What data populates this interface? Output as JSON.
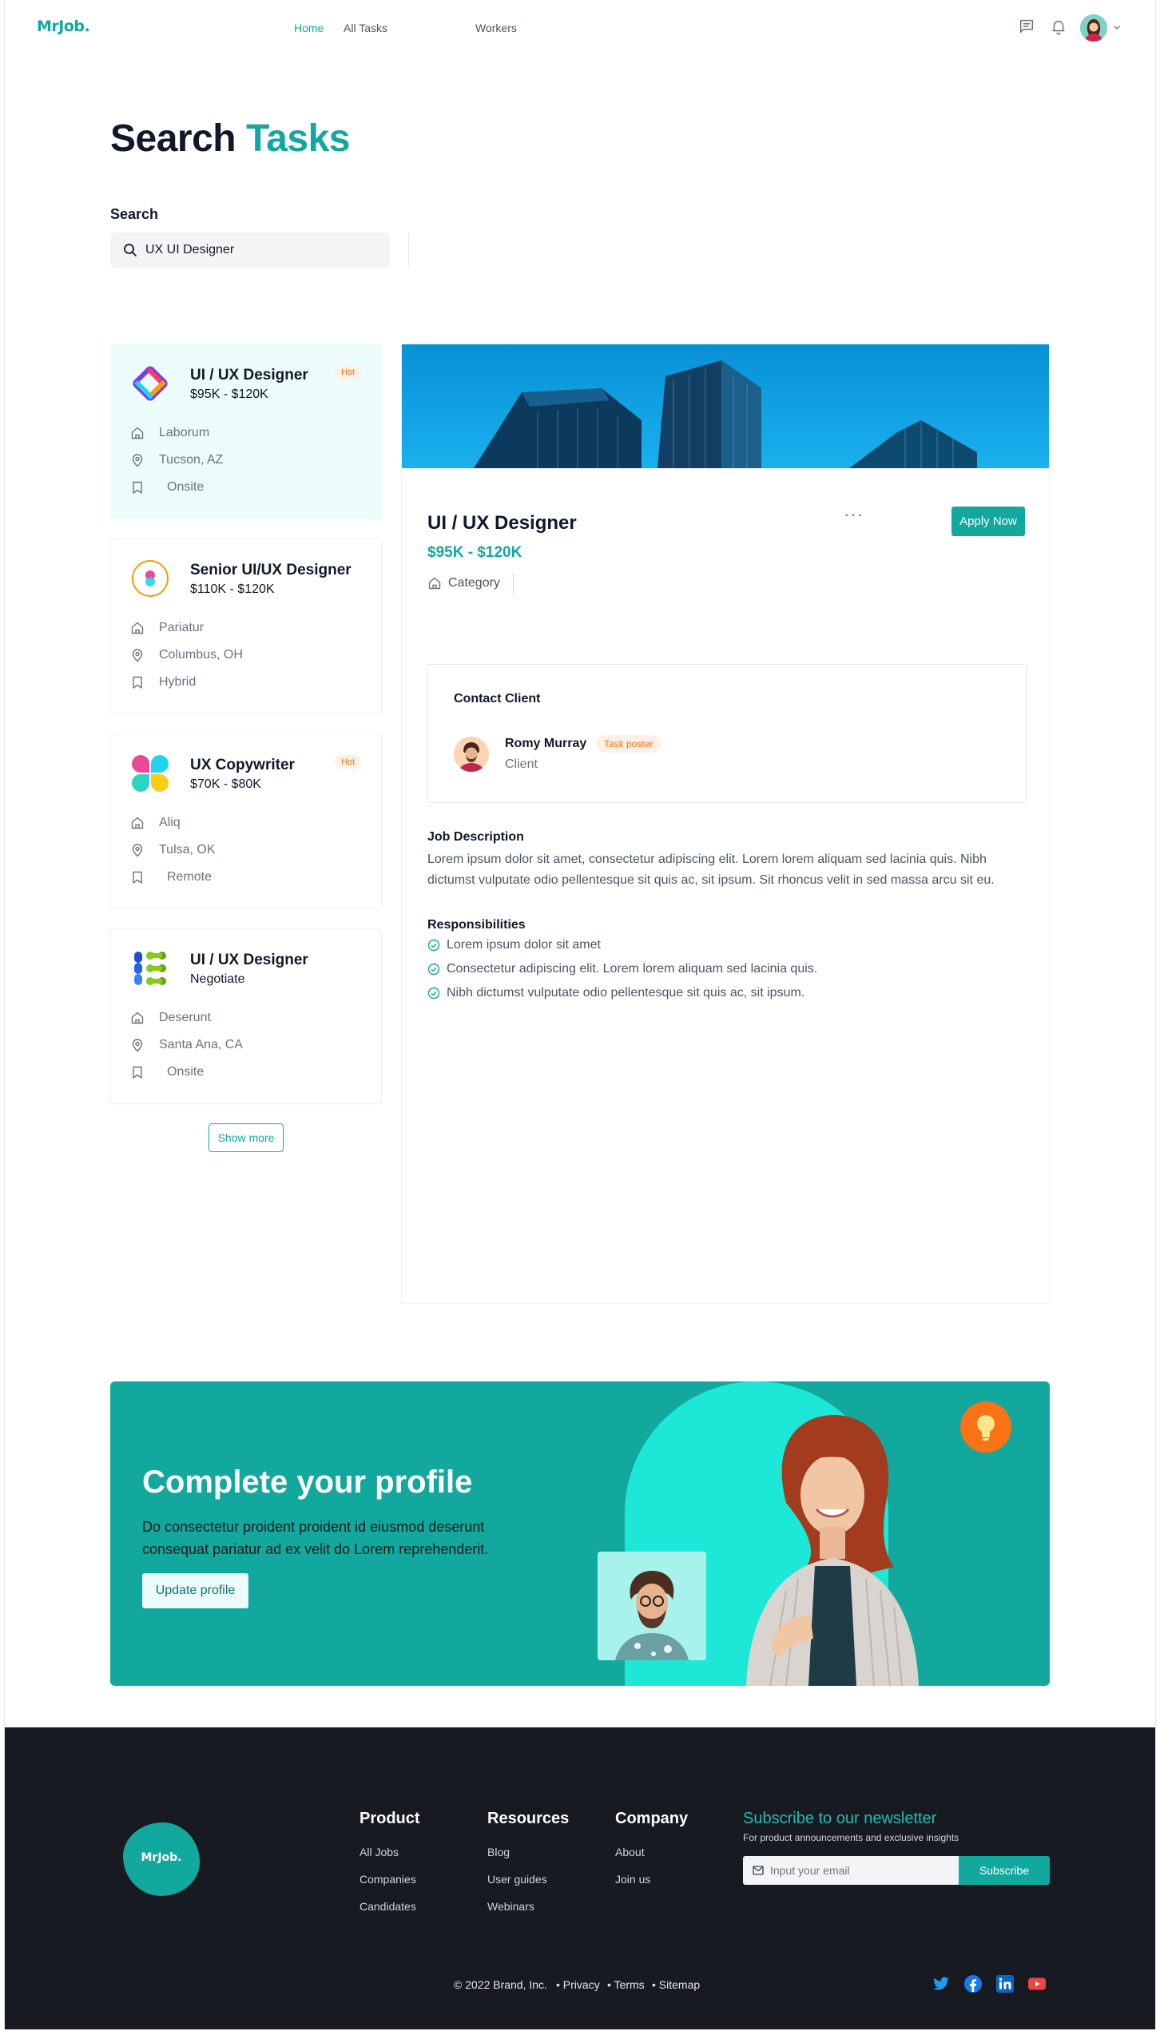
{
  "header": {
    "logo": "MrJob.",
    "nav": [
      {
        "label": "Home",
        "active": true
      },
      {
        "label": "All Tasks",
        "active": false
      },
      {
        "label": "Workers",
        "active": false
      }
    ],
    "icons": [
      "message-icon",
      "bell-icon",
      "avatar",
      "chevron-down-icon"
    ]
  },
  "title": {
    "prefix": "Search",
    "accent": "Tasks",
    "accent_color": "#13a89e"
  },
  "search": {
    "label": "Search",
    "value": "UX UI Designer",
    "icon": "search-icon"
  },
  "jobs": [
    {
      "title": "UI / UX Designer",
      "salary": "$95K - $120K",
      "badge": "Hot",
      "company": "Laborum",
      "location": "Tucson, AZ",
      "type": "Onsite",
      "selected": true
    },
    {
      "title": "Senior UI/UX Designer",
      "salary": "$110K - $120K",
      "badge": "",
      "company": "Pariatur",
      "location": "Columbus, OH",
      "type": "Hybrid",
      "selected": false
    },
    {
      "title": "UX Copywriter",
      "salary": "$70K - $80K",
      "badge": "Hot",
      "company": "Aliq",
      "location": "Tulsa, OK",
      "type": "Remote",
      "selected": false
    },
    {
      "title": "UI / UX Designer",
      "salary": "Negotiate",
      "badge": "",
      "company": "Deserunt",
      "location": "Santa Ana, CA",
      "type": "Onsite",
      "selected": false
    }
  ],
  "show_more": "Show more",
  "detail": {
    "title": "UI / UX Designer",
    "salary": "$95K - $120K",
    "category": "Category",
    "more": "···",
    "apply": "Apply Now",
    "contact": {
      "heading": "Contact Client",
      "name": "Romy Murray",
      "badge": "Task poster",
      "role": "Client"
    },
    "job_description_title": "Job Description",
    "job_description": "Lorem ipsum dolor sit amet, consectetur adipiscing elit. Lorem lorem aliquam sed lacinia quis. Nibh dictumst vulputate odio pellentesque sit quis ac, sit ipsum. Sit rhoncus velit in sed massa arcu sit eu.",
    "responsibilities_title": "Responsibilities",
    "responsibilities": [
      "Lorem ipsum dolor sit amet",
      "Consectetur adipiscing elit. Lorem lorem aliquam sed lacinia quis.",
      "Nibh dictumst vulputate odio pellentesque sit quis ac, sit ipsum."
    ]
  },
  "cta": {
    "title": "Complete your profile",
    "text": "Do consectetur proident proident id eiusmod deserunt consequat pariatur ad ex velit do Lorem reprehenderit.",
    "button": "Update profile"
  },
  "footer": {
    "logo": "MrJob.",
    "columns": [
      {
        "title": "Product",
        "links": [
          "All Jobs",
          "Companies",
          "Candidates"
        ]
      },
      {
        "title": "Resources",
        "links": [
          "Blog",
          "User guides",
          "Webinars"
        ]
      },
      {
        "title": "Company",
        "links": [
          "About",
          "Join us"
        ]
      }
    ],
    "newsletter": {
      "title": "Subscribe to our newsletter",
      "subtitle": "For product announcements and exclusive insights",
      "placeholder": "Input your email",
      "button": "Subscribe"
    },
    "copyright": "© 2022 Brand, Inc.",
    "legal": [
      "• Privacy",
      "• Terms",
      "• Sitemap"
    ],
    "social": [
      "twitter-icon",
      "facebook-icon",
      "linkedin-icon",
      "youtube-icon"
    ]
  }
}
